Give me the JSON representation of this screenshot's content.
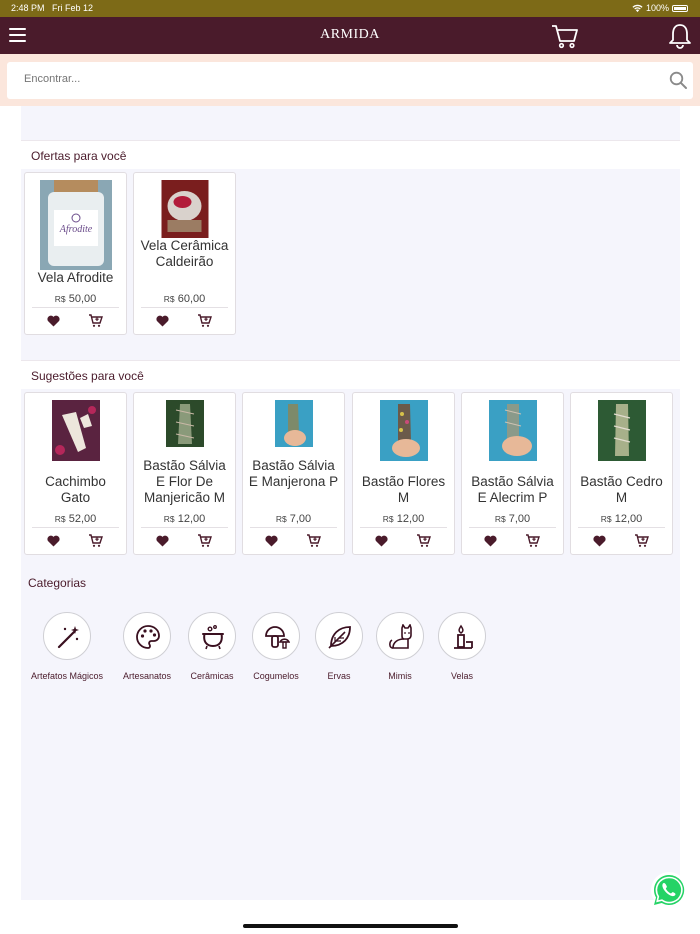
{
  "status_bar": {
    "time": "2:48 PM",
    "date": "Fri Feb 12",
    "battery": "100%"
  },
  "header": {
    "title": "ARMIDA"
  },
  "search": {
    "placeholder": "Encontrar..."
  },
  "offers": {
    "title": "Ofertas para você",
    "products": [
      {
        "name": "Vela Afrodite",
        "currency": "R$",
        "price": "50,00"
      },
      {
        "name": "Vela Cerâmica Caldeirão",
        "currency": "R$",
        "price": "60,00"
      }
    ]
  },
  "suggestions": {
    "title": "Sugestões para você",
    "products": [
      {
        "name": "Cachimbo Gato",
        "currency": "R$",
        "price": "52,00"
      },
      {
        "name": "Bastão Sálvia E Flor De Manjericão M",
        "currency": "R$",
        "price": "12,00"
      },
      {
        "name": "Bastão Sálvia E Manjerona P",
        "currency": "R$",
        "price": "7,00"
      },
      {
        "name": "Bastão Flores M",
        "currency": "R$",
        "price": "12,00"
      },
      {
        "name": "Bastão Sálvia E Alecrim P",
        "currency": "R$",
        "price": "7,00"
      },
      {
        "name": "Bastão Cedro M",
        "currency": "R$",
        "price": "12,00"
      }
    ]
  },
  "categories": {
    "title": "Categorias",
    "items": [
      {
        "label": "Artefatos Mágicos",
        "icon": "magic-wand-icon"
      },
      {
        "label": "Artesanatos",
        "icon": "palette-icon"
      },
      {
        "label": "Cerâmicas",
        "icon": "cauldron-icon"
      },
      {
        "label": "Cogumelos",
        "icon": "mushroom-icon"
      },
      {
        "label": "Ervas",
        "icon": "leaf-icon"
      },
      {
        "label": "Mimis",
        "icon": "cat-icon"
      },
      {
        "label": "Velas",
        "icon": "candle-icon"
      }
    ]
  },
  "colors": {
    "primary": "#4a1b2b",
    "status_bar": "#7d6a17",
    "search_bg": "#fbe6dc",
    "content_bg": "#f5f5fc",
    "whatsapp": "#25d366"
  }
}
